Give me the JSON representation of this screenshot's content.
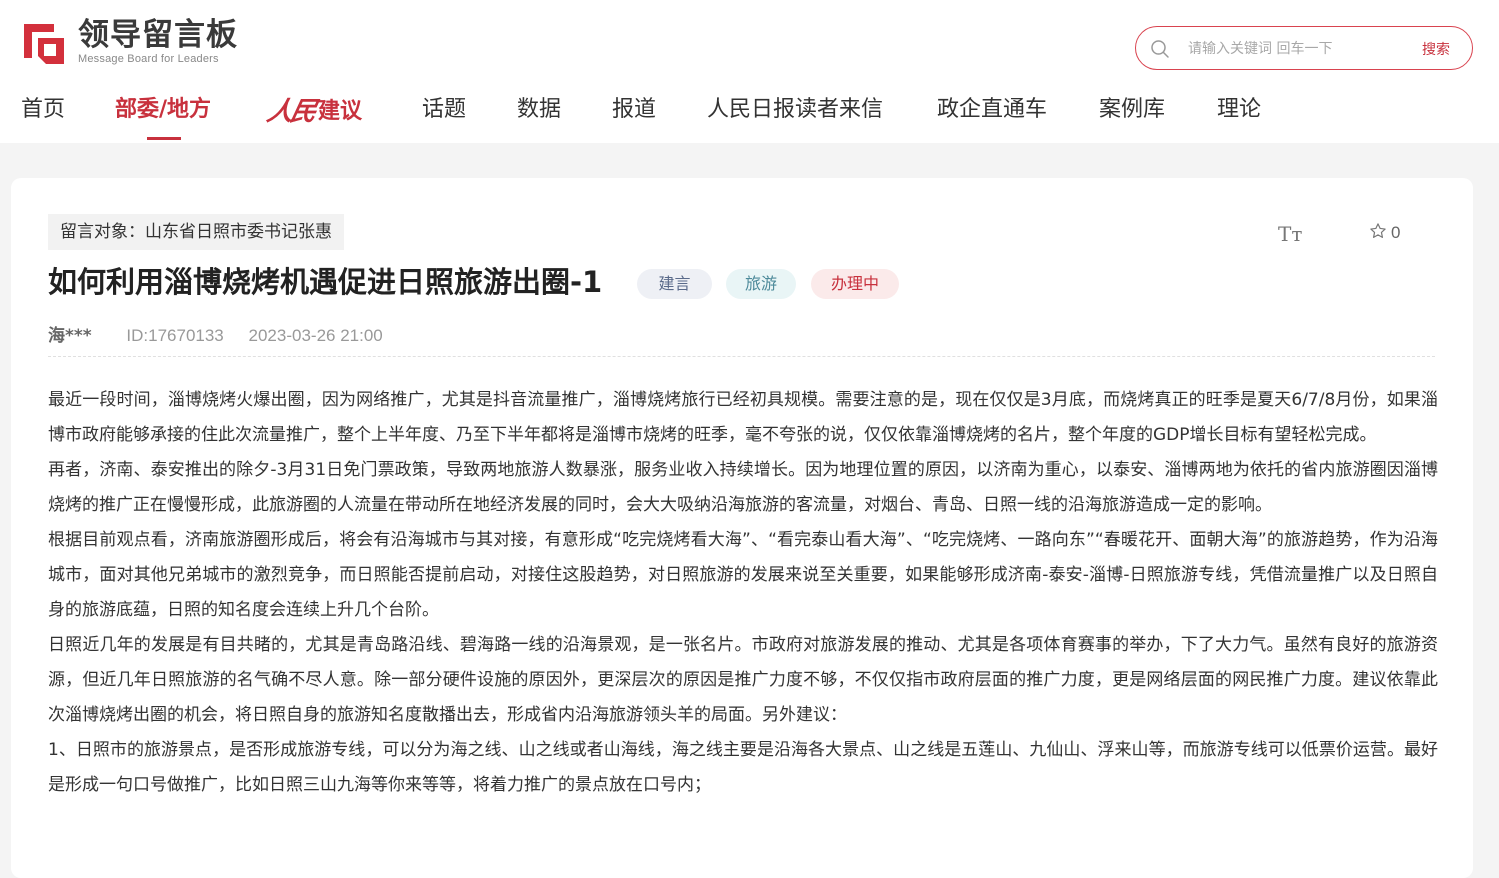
{
  "header": {
    "logo_cn": "领导留言板",
    "logo_en": "Message Board for Leaders",
    "logo_icon": "logo-mark-icon",
    "search": {
      "placeholder": "请输入关键词 回车一下",
      "button_label": "搜索"
    },
    "nav": [
      {
        "label": "首页",
        "active": false
      },
      {
        "label": "部委/地方",
        "active": true
      },
      {
        "label": "人民建议",
        "mark": "人民",
        "text": "建议",
        "active": false
      },
      {
        "label": "话题",
        "active": false
      },
      {
        "label": "数据",
        "active": false
      },
      {
        "label": "报道",
        "active": false
      },
      {
        "label": "人民日报读者来信",
        "active": false
      },
      {
        "label": "政企直通车",
        "active": false
      },
      {
        "label": "案例库",
        "active": false
      },
      {
        "label": "理论",
        "active": false
      }
    ]
  },
  "message": {
    "target": "留言对象：山东省日照市委书记张惠",
    "font_tool_label": "Tт",
    "favorite_count": "0",
    "title": "如何利用淄博烧烤机遇促进日照旅游出圈-1",
    "badges": {
      "type": "建言",
      "field": "旅游",
      "status": "办理中"
    },
    "author": "海***",
    "id": "ID:17670133",
    "datetime": "2023-03-26 21:00",
    "paragraphs": [
      "最近一段时间，淄博烧烤火爆出圈，因为网络推广，尤其是抖音流量推广，淄博烧烤旅行已经初具规模。需要注意的是，现在仅仅是3月底，而烧烤真正的旺季是夏天6/7/8月份，如果淄博市政府能够承接的住此次流量推广，整个上半年度、乃至下半年都将是淄博市烧烤的旺季，毫不夸张的说，仅仅依靠淄博烧烤的名片，整个年度的GDP增长目标有望轻松完成。",
      "再者，济南、泰安推出的除夕-3月31日免门票政策，导致两地旅游人数暴涨，服务业收入持续增长。因为地理位置的原因，以济南为重心，以泰安、淄博两地为依托的省内旅游圈因淄博烧烤的推广正在慢慢形成，此旅游圈的人流量在带动所在地经济发展的同时，会大大吸纳沿海旅游的客流量，对烟台、青岛、日照一线的沿海旅游造成一定的影响。",
      "根据目前观点看，济南旅游圈形成后，将会有沿海城市与其对接，有意形成“吃完烧烤看大海”、“看完泰山看大海”、“吃完烧烤、一路向东”“春暖花开、面朝大海”的旅游趋势，作为沿海城市，面对其他兄弟城市的激烈竞争，而日照能否提前启动，对接住这股趋势，对日照旅游的发展来说至关重要，如果能够形成济南-泰安-淄博-日照旅游专线，凭借流量推广以及日照自身的旅游底蕴，日照的知名度会连续上升几个台阶。",
      "日照近几年的发展是有目共睹的，尤其是青岛路沿线、碧海路一线的沿海景观，是一张名片。市政府对旅游发展的推动、尤其是各项体育赛事的举办，下了大力气。虽然有良好的旅游资源，但近几年日照旅游的名气确不尽人意。除一部分硬件设施的原因外，更深层次的原因是推广力度不够，不仅仅指市政府层面的推广力度，更是网络层面的网民推广力度。建议依靠此次淄博烧烤出圈的机会，将日照自身的旅游知名度散播出去，形成省内沿海旅游领头羊的局面。另外建议：",
      "1、日照市的旅游景点，是否形成旅游专线，可以分为海之线、山之线或者山海线，海之线主要是沿海各大景点、山之线是五莲山、九仙山、浮来山等，而旅游专线可以低票价运营。最好是形成一句口号做推广，比如日照三山九海等你来等等，将着力推广的景点放在口号内；"
    ],
    "colors": {
      "accent": "#c8313d",
      "background": "#f4f4f4"
    }
  }
}
